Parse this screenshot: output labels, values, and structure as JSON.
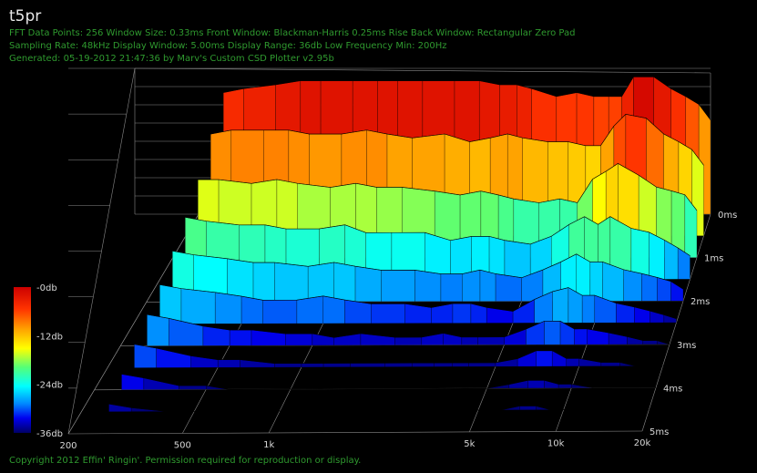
{
  "header": {
    "title": "t5pr",
    "line1": "FFT Data Points: 256  Window Size: 0.33ms   Front Window: Blackman-Harris 0.25ms Rise   Back Window: Rectangular Zero Pad",
    "line2": "Sampling Rate: 48kHz  Display Window: 5.00ms   Display Range: 36db  Low Frequency Min: 200Hz",
    "line3": "Generated: 05-19-2012 21:47:36 by Marv's Custom CSD Plotter v2.95b"
  },
  "footer": {
    "copyright": "Copyright 2012 Effin' Ringin'. Permission required for reproduction or display."
  },
  "colors": {
    "background": "#000000",
    "grid": "#8a8a8a",
    "info_text": "#2f9a2f",
    "title_text": "#e8e8e8"
  },
  "chart_data": {
    "type": "waterfall",
    "x_scale": "log",
    "xlim": [
      200,
      20000
    ],
    "x_ticks": [
      "200",
      "500",
      "1k",
      "5k",
      "10k",
      "20k"
    ],
    "x_tick_values": [
      200,
      500,
      1000,
      5000,
      10000,
      20000
    ],
    "t_ticks": [
      "0ms",
      "1ms",
      "2ms",
      "3ms",
      "4ms",
      "5ms"
    ],
    "t_tick_values": [
      0,
      1,
      2,
      3,
      4,
      5
    ],
    "zlim": [
      -36,
      0
    ],
    "z_ticks": [
      "-0db",
      "-12db",
      "-24db",
      "-36db"
    ],
    "z_tick_values": [
      0,
      -12,
      -24,
      -36
    ],
    "freq_hz": [
      250,
      300,
      400,
      500,
      600,
      800,
      1000,
      1200,
      1500,
      2000,
      2500,
      3000,
      3500,
      4000,
      5000,
      6000,
      7000,
      8000,
      9000,
      10000,
      12000,
      14000,
      16000,
      18000,
      20000
    ],
    "slices": [
      {
        "t_ms": 0.0,
        "db": [
          -5,
          -4,
          -3,
          -2,
          -2,
          -2,
          -2,
          -2,
          -2,
          -2,
          -2,
          -3,
          -3,
          -4,
          -6,
          -5,
          -6,
          -6,
          -6,
          -1,
          -1,
          -4,
          -6,
          -8,
          -12
        ]
      },
      {
        "t_ms": 0.5,
        "db": [
          -10,
          -9,
          -9,
          -9,
          -10,
          -10,
          -9,
          -10,
          -11,
          -10,
          -12,
          -11,
          -10,
          -11,
          -12,
          -12,
          -13,
          -13,
          -8,
          -5,
          -6,
          -10,
          -12,
          -14,
          -18
        ]
      },
      {
        "t_ms": 1.0,
        "db": [
          -16,
          -16,
          -17,
          -16,
          -17,
          -18,
          -17,
          -18,
          -18,
          -19,
          -20,
          -19,
          -20,
          -21,
          -22,
          -21,
          -22,
          -16,
          -14,
          -12,
          -15,
          -18,
          -19,
          -20,
          -24
        ]
      },
      {
        "t_ms": 1.5,
        "db": [
          -20,
          -21,
          -22,
          -22,
          -23,
          -23,
          -22,
          -24,
          -24,
          -24,
          -26,
          -25,
          -25,
          -26,
          -27,
          -25,
          -22,
          -20,
          -22,
          -20,
          -23,
          -24,
          -26,
          -28,
          -30
        ]
      },
      {
        "t_ms": 2.0,
        "db": [
          -23,
          -24,
          -25,
          -26,
          -26,
          -27,
          -26,
          -27,
          -28,
          -28,
          -29,
          -29,
          -28,
          -29,
          -30,
          -28,
          -26,
          -24,
          -26,
          -26,
          -28,
          -29,
          -30,
          -31,
          -33
        ]
      },
      {
        "t_ms": 2.5,
        "db": [
          -26,
          -27,
          -28,
          -29,
          -30,
          -30,
          -29,
          -30,
          -31,
          -31,
          -32,
          -31,
          -31,
          -32,
          -33,
          -30,
          -28,
          -27,
          -29,
          -29,
          -31,
          -32,
          -33,
          -34,
          -35
        ]
      },
      {
        "t_ms": 3.0,
        "db": [
          -28,
          -29,
          -31,
          -32,
          -32,
          -33,
          -33,
          -34,
          -33,
          -34,
          -34,
          -33,
          -34,
          -34,
          -34,
          -32,
          -30,
          -30,
          -32,
          -32,
          -33,
          -34,
          -35,
          -35,
          -36
        ]
      },
      {
        "t_ms": 3.5,
        "db": [
          -30,
          -31,
          -33,
          -34,
          -34,
          -35,
          -35,
          -35,
          -35,
          -35,
          -35,
          -35,
          -35,
          -35,
          -35,
          -34,
          -32,
          -32,
          -34,
          -34,
          -35,
          -35,
          -36,
          -36,
          -36
        ]
      },
      {
        "t_ms": 4.0,
        "db": [
          -32,
          -33,
          -35,
          -35,
          -36,
          -36,
          -36,
          -36,
          -36,
          -36,
          -36,
          -36,
          -36,
          -36,
          -36,
          -35,
          -34,
          -34,
          -35,
          -35,
          -36,
          -36,
          -36,
          -36,
          -36
        ]
      },
      {
        "t_ms": 4.5,
        "db": [
          -34,
          -35,
          -36,
          -36,
          -36,
          -36,
          -36,
          -36,
          -36,
          -36,
          -36,
          -36,
          -36,
          -36,
          -36,
          -36,
          -35,
          -35,
          -36,
          -36,
          -36,
          -36,
          -36,
          -36,
          -36
        ]
      }
    ]
  }
}
